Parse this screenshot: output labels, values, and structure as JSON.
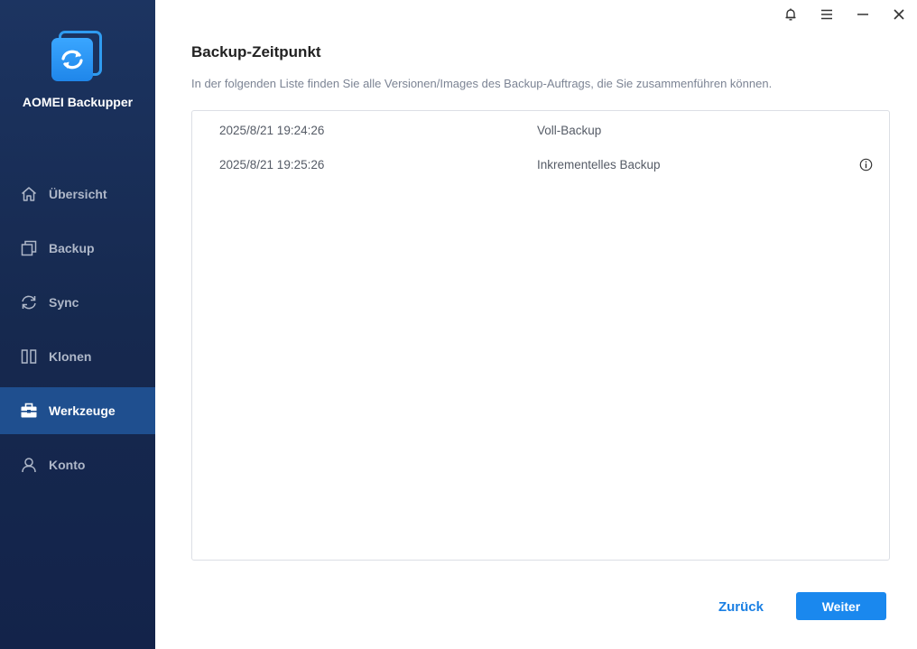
{
  "app": {
    "name": "AOMEI Backupper",
    "accent": "#1a88ee",
    "sidebar_bg": "#16294f"
  },
  "window_controls": [
    {
      "name": "bell-icon"
    },
    {
      "name": "menu-icon"
    },
    {
      "name": "minimize-icon"
    },
    {
      "name": "close-icon"
    }
  ],
  "sidebar": {
    "items": [
      {
        "label": "Übersicht",
        "icon": "home-icon",
        "active": false
      },
      {
        "label": "Backup",
        "icon": "backup-icon",
        "active": false
      },
      {
        "label": "Sync",
        "icon": "sync-icon",
        "active": false
      },
      {
        "label": "Klonen",
        "icon": "clone-icon",
        "active": false
      },
      {
        "label": "Werkzeuge",
        "icon": "toolbox-icon",
        "active": true
      },
      {
        "label": "Konto",
        "icon": "user-icon",
        "active": false
      }
    ]
  },
  "main": {
    "title": "Backup-Zeitpunkt",
    "description": "In der folgenden Liste finden Sie alle Versionen/Images des Backup-Auftrags, die Sie zusammenführen können.",
    "rows": [
      {
        "time": "2025/8/21 19:24:26",
        "type": "Voll-Backup",
        "info": false
      },
      {
        "time": "2025/8/21 19:25:26",
        "type": "Inkrementelles Backup",
        "info": true
      }
    ]
  },
  "footer": {
    "back_label": "Zurück",
    "next_label": "Weiter"
  }
}
